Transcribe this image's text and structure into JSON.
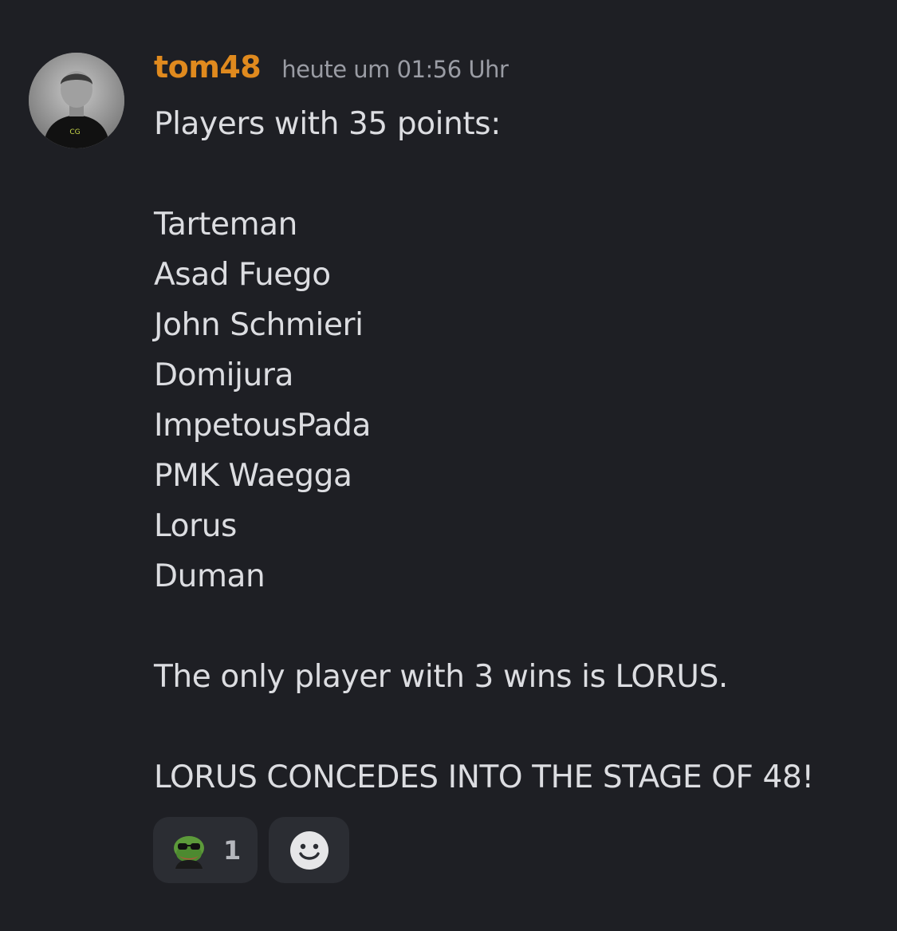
{
  "message": {
    "author": "tom48",
    "timestamp": "heute um 01:56 Uhr",
    "author_color": "#e08a1e",
    "intro": "Players with 35 points:",
    "players": [
      "Tarteman",
      "Asad Fuego",
      "John Schmieri",
      "Domijura",
      "ImpetousPada",
      "PMK Waegga",
      "Lorus",
      "Duman"
    ],
    "note": "The only player with 3 wins is LORUS.",
    "announcement": "LORUS CONCEDES INTO THE STAGE OF 48!"
  },
  "reactions": [
    {
      "emoji": "pepe-sunglasses-emoji",
      "count": "1"
    }
  ],
  "add_reaction_icon": "smiley-add-reaction-icon"
}
